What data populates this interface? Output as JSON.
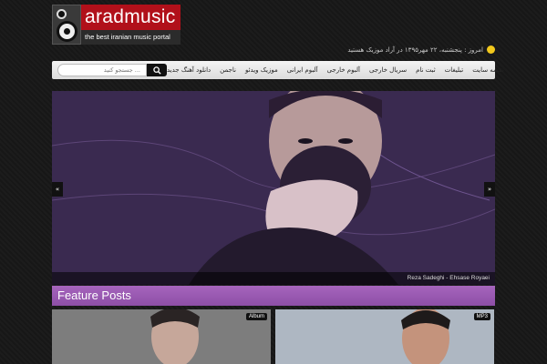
{
  "logo": {
    "name": "aradmusic",
    "tagline": "the best iranian music portal"
  },
  "date_line": "امروز : پنجشنبه، ۲۲ مهر۱۳۹۵ در آراد موزیک هستید",
  "nav": {
    "items": [
      "دانلود آهنگ جدید",
      "ناجمن",
      "موزیک ویدئو",
      "آلبوم ایرانی",
      "آلبوم خارجی",
      "سریال خارجی",
      "ثبت نام",
      "تبلیغات",
      "نقشه سایت"
    ],
    "search_placeholder": "جستجو کنید ..."
  },
  "slider": {
    "caption": "Reza Sadeghi - Ehsase Royaei",
    "prev_label": "«",
    "next_label": "»"
  },
  "feature": {
    "title": "Feature Posts"
  },
  "posts": [
    {
      "badge": "Album"
    },
    {
      "badge": "MP3"
    }
  ],
  "colors": {
    "brand_red": "#b1101a",
    "feature_purple": "#9b59b6"
  }
}
